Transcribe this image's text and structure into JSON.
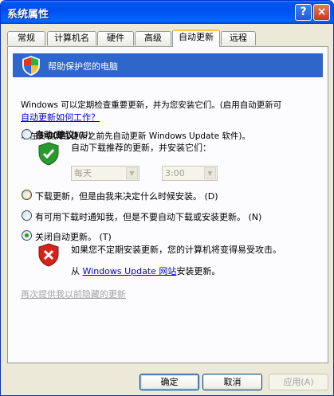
{
  "window": {
    "title": "系统属性",
    "help_glyph": "?",
    "close_glyph": "×"
  },
  "tabs": [
    {
      "label": "常规"
    },
    {
      "label": "计算机名"
    },
    {
      "label": "硬件"
    },
    {
      "label": "高级"
    },
    {
      "label": "自动更新",
      "active": true
    },
    {
      "label": "远程"
    }
  ],
  "banner": {
    "text": "帮助保护您的电脑",
    "icon": "security-shield-icon"
  },
  "intro": {
    "line1": "Windows 可以定期检查重要更新，并为您安装它们。(启用自动更新可",
    "line2": "以在安装其它更新之前先自动更新 Windows Update 软件)。"
  },
  "how_link": "自动更新如何工作？",
  "options": {
    "auto": {
      "label": "自动(建议)",
      "hotkey": "(U)",
      "desc": "自动下载推荐的更新，并安装它们：",
      "day_value": "每天",
      "time_value": "3:00",
      "icon": "green-shield-check-icon"
    },
    "download": {
      "label": "下载更新，但是由我来决定什么时候安装。",
      "hotkey": "(D)"
    },
    "notify": {
      "label": "有可用下载时通知我，但是不要自动下载或安装更新。",
      "hotkey": "(N)"
    },
    "off": {
      "label": "关闭自动更新。",
      "hotkey": "(T)",
      "desc": "如果您不定期安装更新，您的计算机将变得易受攻击。",
      "desc2_prefix": "从",
      "desc2_link": "Windows Update 网站",
      "desc2_suffix": "安装更新。",
      "icon": "red-shield-x-icon"
    }
  },
  "selected_option": "off",
  "hidden_updates_link": "再次提供我以前隐藏的更新",
  "buttons": {
    "ok": "确定",
    "cancel": "取消",
    "apply": "应用(A)"
  },
  "colors": {
    "titlebar": "#0053EE",
    "banner": "#2E66C9",
    "active_tab_accent": "#FFC83C",
    "link": "#0000EE"
  }
}
